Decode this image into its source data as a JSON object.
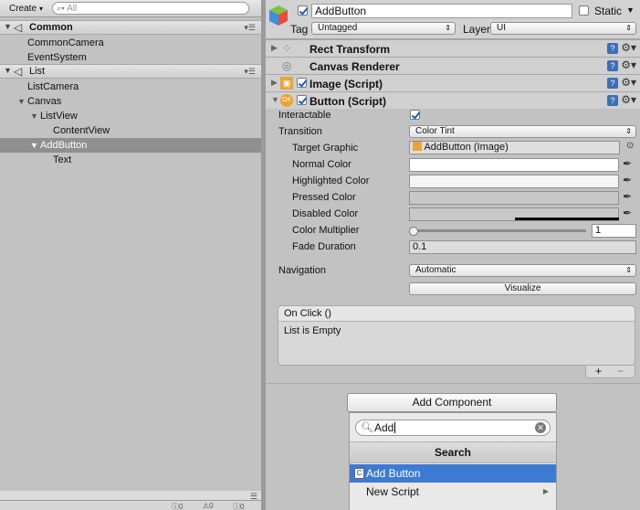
{
  "hierarchy": {
    "create_label": "Create",
    "search_placeholder": "All",
    "scenes": [
      {
        "name": "Common",
        "items": [
          "CommonCamera",
          "EventSystem"
        ]
      },
      {
        "name": "List",
        "items": [
          "ListCamera",
          "Canvas",
          "ListView",
          "ContentView",
          "AddButton",
          "Text"
        ]
      }
    ],
    "selected_item": "AddButton",
    "badges": [
      "0",
      "0",
      "0"
    ]
  },
  "inspector": {
    "object_name": "AddButton",
    "static_label": "Static",
    "tag_label": "Tag",
    "tag_value": "Untagged",
    "layer_label": "Layer",
    "layer_value": "UI",
    "components": [
      {
        "name": "Rect Transform",
        "icon": "rect-transform-icon"
      },
      {
        "name": "Canvas Renderer",
        "icon": "canvas-renderer-icon"
      },
      {
        "name": "Image (Script)",
        "icon": "image-script-icon"
      },
      {
        "name": "Button (Script)",
        "icon": "button-script-icon"
      }
    ],
    "button": {
      "interactable_label": "Interactable",
      "interactable_checked": true,
      "transition_label": "Transition",
      "transition_value": "Color Tint",
      "target_graphic_label": "Target Graphic",
      "target_graphic_value": "AddButton (Image)",
      "normal_color_label": "Normal Color",
      "normal_color": "#ffffff",
      "highlighted_color_label": "Highlighted Color",
      "highlighted_color": "#f5f5f5",
      "pressed_color_label": "Pressed Color",
      "pressed_color": "#c8c8c8",
      "disabled_color_label": "Disabled Color",
      "disabled_color": "#c8c8c8",
      "color_multiplier_label": "Color Multiplier",
      "color_multiplier": "1",
      "color_multiplier_fraction": 0.0,
      "fade_duration_label": "Fade Duration",
      "fade_duration": "0.1",
      "navigation_label": "Navigation",
      "navigation_value": "Automatic",
      "visualize_label": "Visualize",
      "onclick_label": "On Click ()",
      "onclick_empty": "List is Empty",
      "plus": "+",
      "minus": "−"
    },
    "add_component_label": "Add Component",
    "popup": {
      "search_value": "Add",
      "header": "Search",
      "items": [
        "Add Button",
        "New Script"
      ],
      "selected_index": 0
    }
  }
}
